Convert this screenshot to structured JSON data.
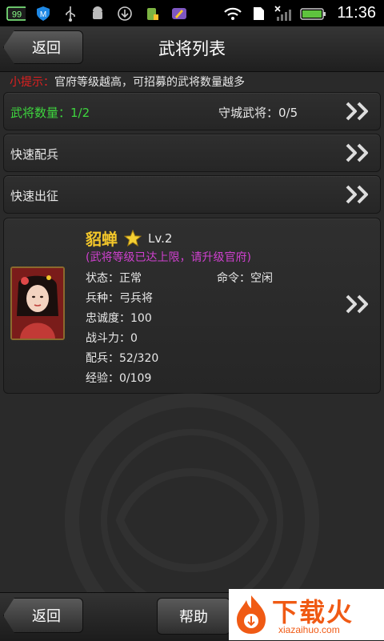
{
  "status_bar": {
    "battery_badge": "99",
    "time": "11:36"
  },
  "header": {
    "back_label": "返回",
    "title": "武将列表"
  },
  "tip": {
    "label": "小提示：",
    "text": "官府等级越高，可招募的武将数量越多"
  },
  "summary": {
    "count_label": "武将数量：1/2",
    "defense_label": "守城武将：0/5"
  },
  "actions": {
    "quick_troops": "快速配兵",
    "quick_march": "快速出征"
  },
  "general": {
    "name": "貂蝉",
    "level": "Lv.2",
    "note": "(武将等级已达上限，请升级官府)",
    "status": "状态：正常",
    "command": "命令：空闲",
    "troop_type": "兵种：弓兵将",
    "loyalty": "忠诚度：100",
    "power": "战斗力：0",
    "troops": "配兵：52/320",
    "exp": "经验：0/109"
  },
  "footer": {
    "back_label": "返回",
    "help_label": "帮助"
  },
  "watermark": {
    "text": "下载火",
    "url": "xiazaihuo.com"
  },
  "colors": {
    "accent_green": "#3ed63e",
    "tip_red": "#e02020",
    "name_gold": "#f2c62a",
    "note_magenta": "#d040d0"
  }
}
